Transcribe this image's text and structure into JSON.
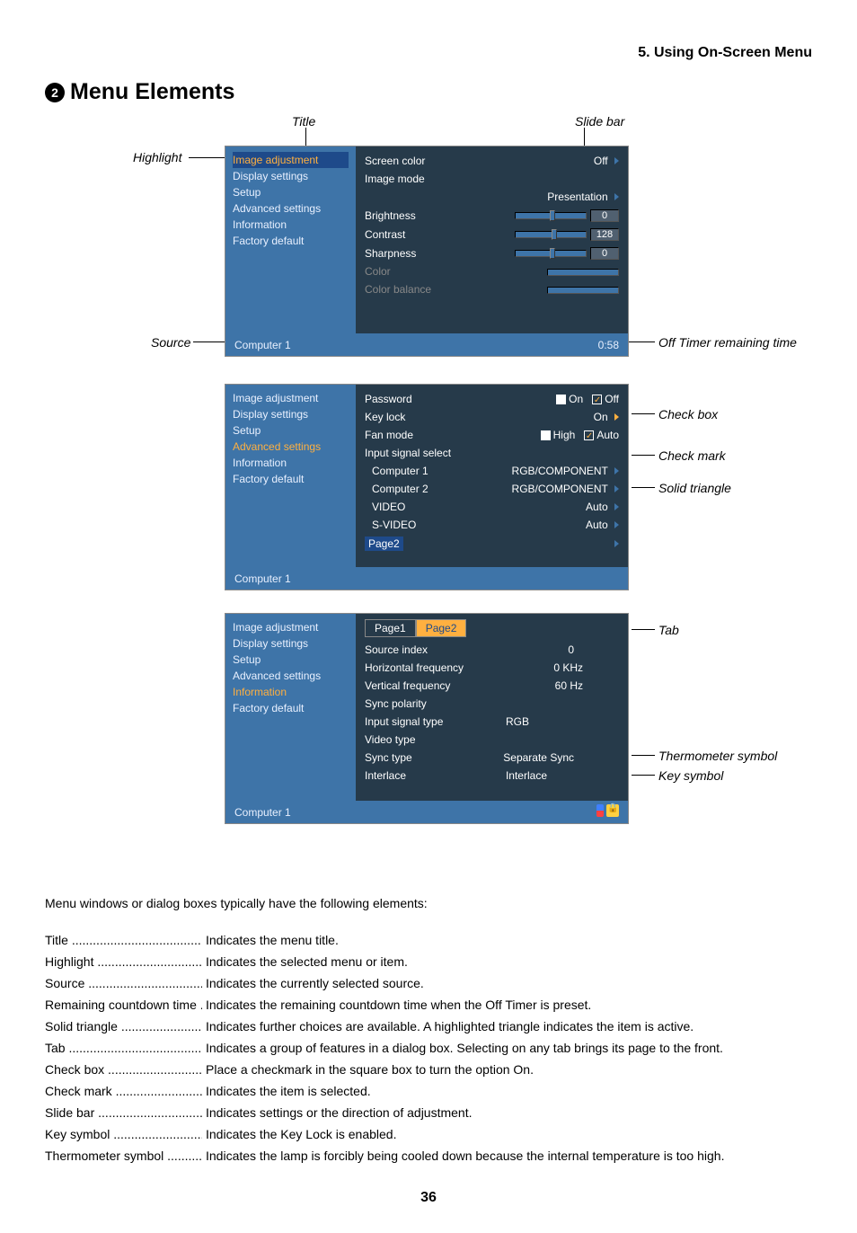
{
  "chapter": "5. Using On-Screen Menu",
  "section_number": "2",
  "section_title": "Menu Elements",
  "callouts": {
    "title": "Title",
    "slide_bar": "Slide bar",
    "highlight": "Highlight",
    "source": "Source",
    "off_timer": "Off Timer remaining time",
    "check_box": "Check box",
    "check_mark": "Check mark",
    "solid_triangle": "Solid triangle",
    "tab": "Tab",
    "thermometer": "Thermometer symbol",
    "key_symbol": "Key symbol"
  },
  "menu1": {
    "sidebar": [
      "Image adjustment",
      "Display settings",
      "Setup",
      "Advanced settings",
      "Information",
      "Factory default"
    ],
    "highlighted": "Image adjustment",
    "rows": {
      "screen_color": {
        "label": "Screen color",
        "value": "Off"
      },
      "image_mode": {
        "label": "Image mode",
        "value": "Presentation"
      },
      "brightness": {
        "label": "Brightness",
        "value": "0"
      },
      "contrast": {
        "label": "Contrast",
        "value": "128"
      },
      "sharpness": {
        "label": "Sharpness",
        "value": "0"
      },
      "color": {
        "label": "Color"
      },
      "color_balance": {
        "label": "Color balance"
      }
    },
    "status_source": "Computer 1",
    "status_time": "0:58"
  },
  "menu2": {
    "sidebar": [
      "Image adjustment",
      "Display settings",
      "Setup",
      "Advanced settings",
      "Information",
      "Factory default"
    ],
    "highlighted": "Advanced settings",
    "rows": {
      "password": {
        "label": "Password",
        "on": "On",
        "off": "Off"
      },
      "keylock": {
        "label": "Key lock",
        "value": "On"
      },
      "fan_mode": {
        "label": "Fan mode",
        "high": "High",
        "auto": "Auto"
      },
      "input_signal": {
        "label": "Input signal select"
      },
      "computer1": {
        "label": "Computer 1",
        "value": "RGB/COMPONENT"
      },
      "computer2": {
        "label": "Computer 2",
        "value": "RGB/COMPONENT"
      },
      "video": {
        "label": "VIDEO",
        "value": "Auto"
      },
      "svideo": {
        "label": "S-VIDEO",
        "value": "Auto"
      },
      "page2": {
        "label": "Page2"
      }
    },
    "status_source": "Computer 1"
  },
  "menu3": {
    "sidebar": [
      "Image adjustment",
      "Display settings",
      "Setup",
      "Advanced settings",
      "Information",
      "Factory default"
    ],
    "highlighted": "Information",
    "tabs": {
      "page1": "Page1",
      "page2": "Page2"
    },
    "rows": {
      "source_index": {
        "label": "Source index",
        "value": "0"
      },
      "h_freq": {
        "label": "Horizontal frequency",
        "value": "0 KHz"
      },
      "v_freq": {
        "label": "Vertical frequency",
        "value": "60 Hz"
      },
      "sync_pol": {
        "label": "Sync polarity"
      },
      "input_type": {
        "label": "Input signal type",
        "value": "RGB"
      },
      "video_type": {
        "label": "Video type"
      },
      "sync_type": {
        "label": "Sync type",
        "value": "Separate Sync"
      },
      "interlace": {
        "label": "Interlace",
        "value": "Interlace"
      }
    },
    "status_source": "Computer 1"
  },
  "intro": "Menu windows or dialog boxes typically have the following elements:",
  "definitions": [
    {
      "term": "Title",
      "d": "..........................................",
      "desc": "Indicates the menu title."
    },
    {
      "term": "Highlight",
      "d": "..................................",
      "desc": "Indicates the selected menu or item."
    },
    {
      "term": "Source",
      "d": ".....................................",
      "desc": "Indicates the currently selected source."
    },
    {
      "term": "Remaining countdown time",
      "d": ".....",
      "desc": "Indicates the remaining countdown time when the Off Timer is preset."
    },
    {
      "term": "Solid triangle",
      "d": "............................",
      "desc": "Indicates further choices are available. A highlighted triangle indicates the item is active."
    },
    {
      "term": "Tab",
      "d": "...........................................",
      "desc": "Indicates a group of features in a dialog box. Selecting on any tab brings its page to the front."
    },
    {
      "term": "Check box",
      "d": "................................",
      "desc": "Place a checkmark in the square box to turn the option On."
    },
    {
      "term": "Check mark",
      "d": ".............................",
      "desc": "Indicates the item is selected."
    },
    {
      "term": "Slide bar",
      "d": "..................................",
      "desc": "Indicates settings or the direction of adjustment."
    },
    {
      "term": "Key symbol",
      "d": "..............................",
      "desc": "Indicates the Key Lock is enabled."
    },
    {
      "term": "Thermometer symbol",
      "d": "...............",
      "desc": "Indicates the lamp is forcibly being cooled down because the internal temperature is too high."
    }
  ],
  "page_number": "36"
}
